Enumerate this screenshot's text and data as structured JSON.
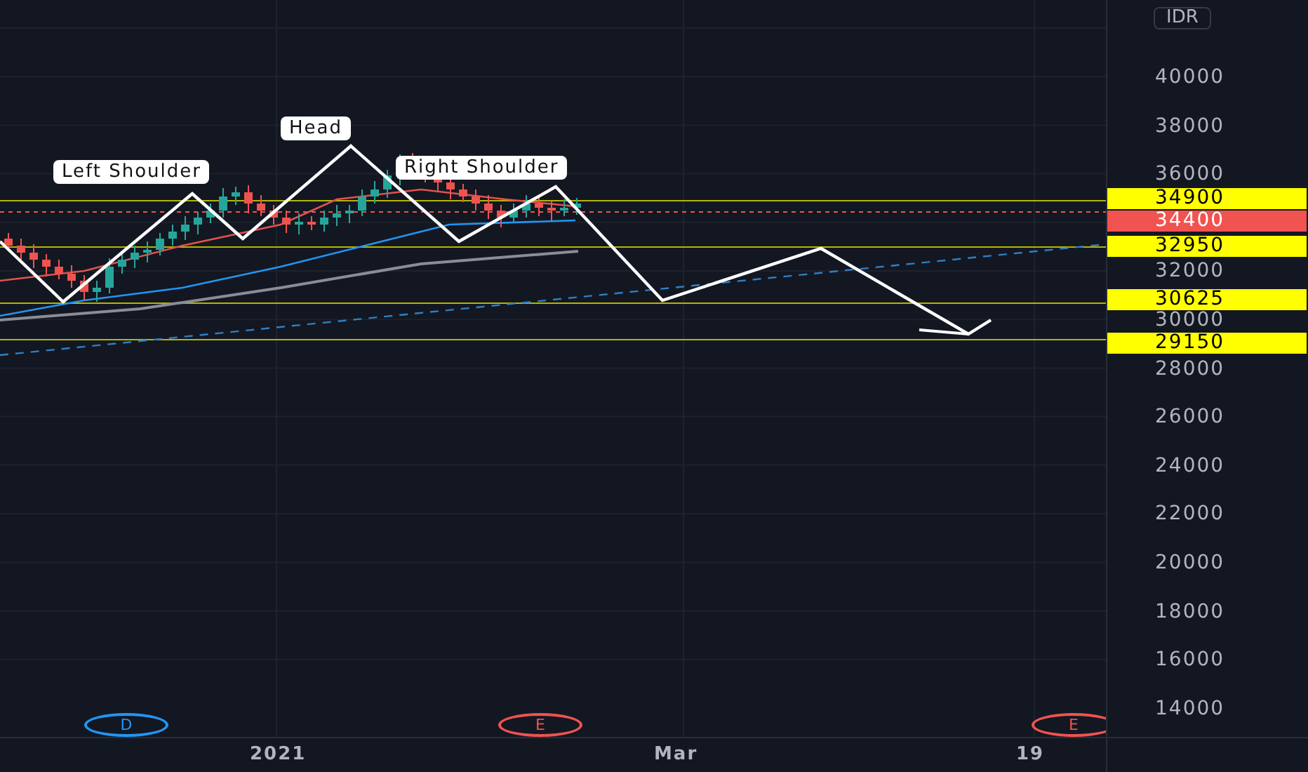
{
  "price_axis": {
    "currency": "IDR",
    "labels": [
      "40000",
      "38000",
      "36000",
      "32000",
      "30000",
      "28000",
      "26000",
      "24000",
      "22000",
      "20000",
      "18000",
      "16000",
      "14000"
    ]
  },
  "price_tags": [
    {
      "value": "34900",
      "color": "#ffff00"
    },
    {
      "value": "34400",
      "color": "#f05350"
    },
    {
      "value": "32950",
      "color": "#ffff00"
    },
    {
      "value": "30625",
      "color": "#ffff00"
    },
    {
      "value": "29150",
      "color": "#ffff00"
    }
  ],
  "pattern_labels": [
    "Left Shoulder",
    "Head",
    "Right Shoulder"
  ],
  "events": [
    {
      "letter": "D",
      "color": "#2196f3"
    },
    {
      "letter": "E",
      "color": "#ef5350"
    },
    {
      "letter": "E",
      "color": "#ef5350"
    }
  ],
  "time_axis": [
    "2021",
    "Mar",
    "19"
  ]
}
